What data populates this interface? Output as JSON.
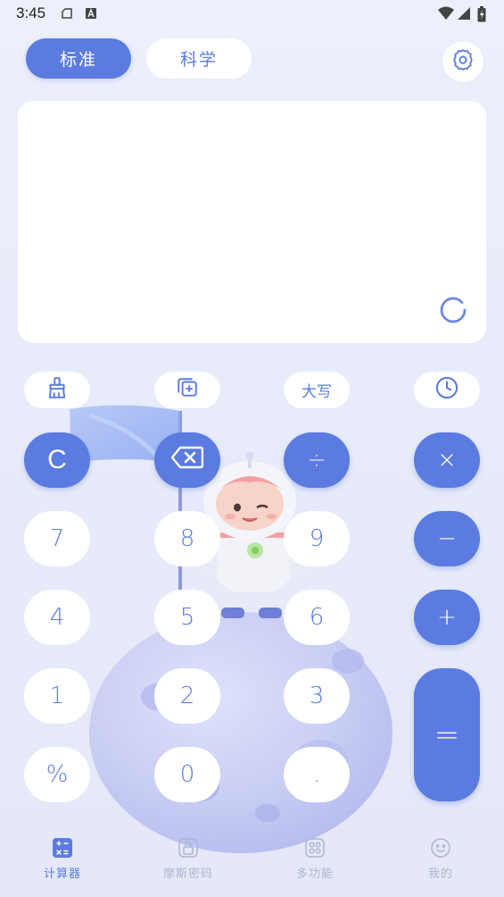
{
  "status_bar": {
    "time": "3:45",
    "icons": [
      "storage-icon",
      "a-badge-icon",
      "wifi-icon",
      "signal-icon",
      "battery-icon"
    ]
  },
  "mode_tabs": [
    {
      "label": "标准",
      "active": true
    },
    {
      "label": "科学",
      "active": false
    }
  ],
  "settings_icon": "gear-icon",
  "display": {
    "expression": "",
    "result": ""
  },
  "function_buttons": [
    {
      "name": "clear-history",
      "icon": "broom-icon"
    },
    {
      "name": "copy",
      "icon": "copy-add-icon"
    },
    {
      "name": "uppercase",
      "label": "大写"
    },
    {
      "name": "history",
      "icon": "clock-icon"
    }
  ],
  "keypad": {
    "clear": "C",
    "divide": "÷",
    "multiply": "×",
    "minus": "−",
    "plus": "+",
    "equals": "=",
    "seven": "7",
    "eight": "8",
    "nine": "9",
    "four": "4",
    "five": "5",
    "six": "6",
    "one": "1",
    "two": "2",
    "three": "3",
    "percent": "%",
    "zero": "0",
    "dot": "."
  },
  "bottom_tabs": [
    {
      "label": "计算器",
      "icon": "calculator-icon",
      "active": true
    },
    {
      "label": "摩斯密码",
      "icon": "lock-icon",
      "active": false
    },
    {
      "label": "多功能",
      "icon": "grid-icon",
      "active": false
    },
    {
      "label": "我的",
      "icon": "smile-icon",
      "active": false
    }
  ],
  "colors": {
    "accent": "#5b7be0",
    "background": "#e9ecfa",
    "key_bg": "#ffffff",
    "inactive_tab": "#aeb6cf"
  }
}
